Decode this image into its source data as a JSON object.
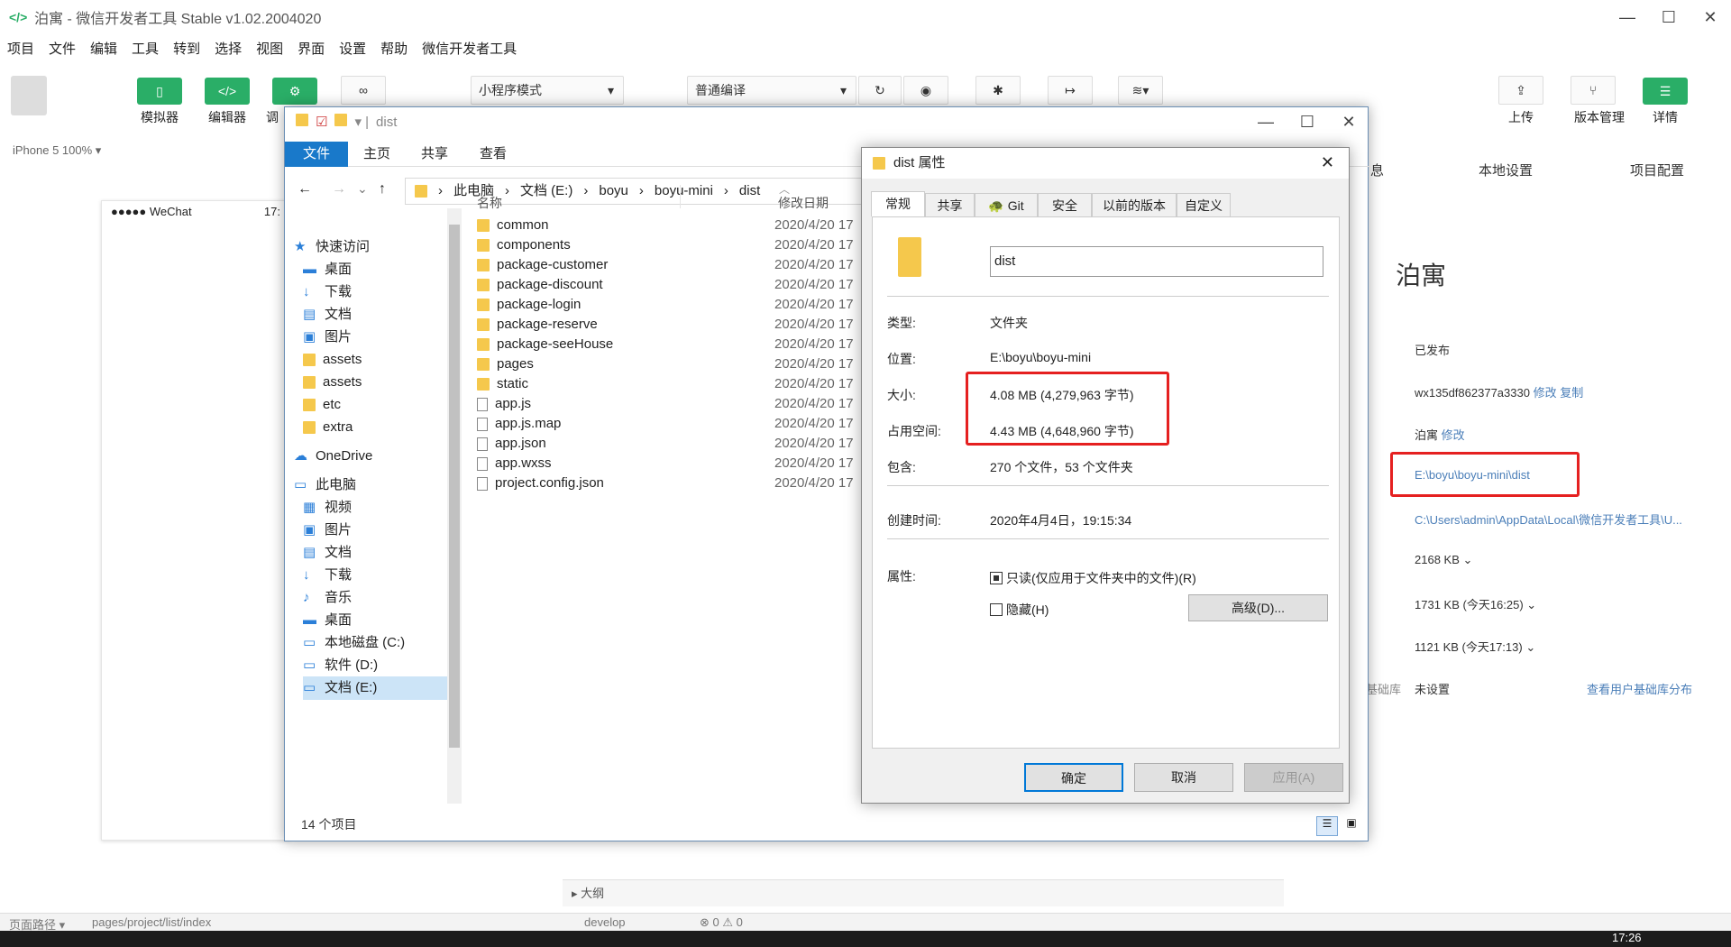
{
  "ide": {
    "title": "泊寓 - 微信开发者工具 Stable v1.02.2004020",
    "menu": [
      "项目",
      "文件",
      "编辑",
      "工具",
      "转到",
      "选择",
      "视图",
      "界面",
      "设置",
      "帮助",
      "微信开发者工具"
    ],
    "toolbar": {
      "simulator": "模拟器",
      "editor": "编辑器",
      "debugger": "调",
      "mode": "小程序模式",
      "compile": "普通编译",
      "upload": "上传",
      "version": "版本管理",
      "details": "详情"
    },
    "device": "iPhone 5 100% ▾",
    "phone_status": "●●●●● WeChat",
    "phone_time": "17:",
    "right_tabs": [
      "息",
      "本地设置",
      "项目配置"
    ],
    "project_name": "泊寓",
    "info": {
      "published": "已发布",
      "appid": "wx135df862377a3330",
      "modify": "修改",
      "copy": "复制",
      "name": "泊寓",
      "name_modify": "修改",
      "local_dir": "E:\\boyu\\boyu-mini\\dist",
      "cache_dir": "C:\\Users\\admin\\AppData\\Local\\微信开发者工具\\U...",
      "size1": "2168 KB",
      "size2": "1731 KB (今天16:25)",
      "size3": "1121 KB (今天17:13)",
      "lib_label": "基础库",
      "lib_value": "未设置",
      "lib_link": "查看用户基础库分布"
    },
    "bottom": {
      "path_label": "页面路径 ▾",
      "path": "pages/project/list/index",
      "branch": "develop",
      "errors": "⊗ 0 ⚠ 0",
      "outline": "大纲"
    },
    "clock": "17:26"
  },
  "explorer": {
    "title": "dist",
    "ribbon": [
      "文件",
      "主页",
      "共享",
      "查看"
    ],
    "crumbs": [
      "此电脑",
      "文档 (E:)",
      "boyu",
      "boyu-mini",
      "dist"
    ],
    "nav": [
      {
        "label": "快速访问",
        "icon": "star-icon"
      },
      {
        "label": "桌面",
        "icon": "desktop-icon"
      },
      {
        "label": "下载",
        "icon": "download-icon"
      },
      {
        "label": "文档",
        "icon": "document-icon"
      },
      {
        "label": "图片",
        "icon": "picture-icon"
      },
      {
        "label": "assets",
        "icon": "folder-icon"
      },
      {
        "label": "assets",
        "icon": "folder-icon"
      },
      {
        "label": "etc",
        "icon": "folder-icon"
      },
      {
        "label": "extra",
        "icon": "folder-icon"
      },
      {
        "label": "OneDrive",
        "icon": "cloud-icon"
      },
      {
        "label": "此电脑",
        "icon": "pc-icon"
      },
      {
        "label": "视频",
        "icon": "video-icon"
      },
      {
        "label": "图片",
        "icon": "picture-icon"
      },
      {
        "label": "文档",
        "icon": "document-icon"
      },
      {
        "label": "下载",
        "icon": "download-icon"
      },
      {
        "label": "音乐",
        "icon": "music-icon"
      },
      {
        "label": "桌面",
        "icon": "desktop-icon"
      },
      {
        "label": "本地磁盘 (C:)",
        "icon": "drive-icon"
      },
      {
        "label": "软件 (D:)",
        "icon": "drive-icon"
      },
      {
        "label": "文档 (E:)",
        "icon": "drive-icon"
      }
    ],
    "col_name": "名称",
    "col_date": "修改日期",
    "files": [
      {
        "name": "common",
        "type": "folder",
        "date": "2020/4/20 17"
      },
      {
        "name": "components",
        "type": "folder",
        "date": "2020/4/20 17"
      },
      {
        "name": "package-customer",
        "type": "folder",
        "date": "2020/4/20 17"
      },
      {
        "name": "package-discount",
        "type": "folder",
        "date": "2020/4/20 17"
      },
      {
        "name": "package-login",
        "type": "folder",
        "date": "2020/4/20 17"
      },
      {
        "name": "package-reserve",
        "type": "folder",
        "date": "2020/4/20 17"
      },
      {
        "name": "package-seeHouse",
        "type": "folder",
        "date": "2020/4/20 17"
      },
      {
        "name": "pages",
        "type": "folder",
        "date": "2020/4/20 17"
      },
      {
        "name": "static",
        "type": "folder",
        "date": "2020/4/20 17"
      },
      {
        "name": "app.js",
        "type": "file",
        "date": "2020/4/20 17"
      },
      {
        "name": "app.js.map",
        "type": "file",
        "date": "2020/4/20 17"
      },
      {
        "name": "app.json",
        "type": "file",
        "date": "2020/4/20 17"
      },
      {
        "name": "app.wxss",
        "type": "file",
        "date": "2020/4/20 17"
      },
      {
        "name": "project.config.json",
        "type": "file",
        "date": "2020/4/20 17"
      }
    ],
    "status": "14 个项目"
  },
  "props": {
    "title": "dist 属性",
    "tabs": [
      "常规",
      "共享",
      "Git",
      "安全",
      "以前的版本",
      "自定义"
    ],
    "name": "dist",
    "type_label": "类型:",
    "type_value": "文件夹",
    "loc_label": "位置:",
    "loc_value": "E:\\boyu\\boyu-mini",
    "size_label": "大小:",
    "size_value": "4.08 MB (4,279,963 字节)",
    "disk_label": "占用空间:",
    "disk_value": "4.43 MB (4,648,960 字节)",
    "contains_label": "包含:",
    "contains_value": "270 个文件，53 个文件夹",
    "created_label": "创建时间:",
    "created_value": "2020年4月4日，19:15:34",
    "attr_label": "属性:",
    "readonly": "只读(仅应用于文件夹中的文件)(R)",
    "hidden": "隐藏(H)",
    "advanced": "高级(D)...",
    "ok": "确定",
    "cancel": "取消",
    "apply": "应用(A)"
  }
}
